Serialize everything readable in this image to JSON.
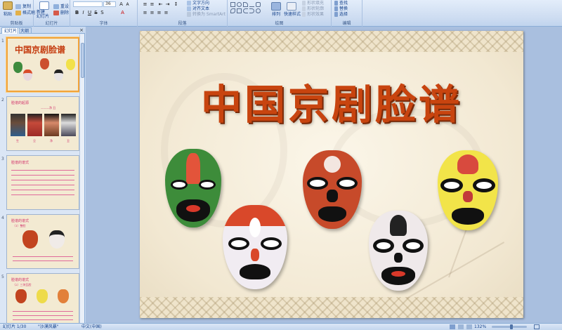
{
  "ribbon": {
    "groups": {
      "clipboard": "剪贴板",
      "slides": "幻灯片",
      "font": "字体",
      "paragraph": "段落",
      "drawing": "绘图",
      "editing": "编辑"
    },
    "paste_label": "粘贴",
    "copy_label": "复制",
    "format_painter_label": "格式刷",
    "new_slide_label": "新建\n幻灯片",
    "reset_label": "重设",
    "delete_label": "删除",
    "font_size": "36",
    "text_direction_label": "文字方向",
    "align_text_label": "对齐文本",
    "smartart_label": "转换为 SmartArt",
    "arrange_label": "排列",
    "quick_styles_label": "快速样式",
    "shape_fill_label": "形状填充",
    "shape_outline_label": "形状轮廓",
    "shape_effects_label": "形状效果",
    "find_label": "查找",
    "replace_label": "替换",
    "select_label": "选择"
  },
  "panel": {
    "tabs": [
      "幻灯片",
      "大纲"
    ],
    "close": "×"
  },
  "thumbnails": [
    {
      "num": "1",
      "title": "中国京剧脸谱"
    },
    {
      "num": "2",
      "title": "脸谱的起源",
      "subtitle": "———净 丑",
      "captions": [
        "生",
        "旦",
        "净",
        "丑"
      ]
    },
    {
      "num": "3",
      "title": "脸谱的谱式"
    },
    {
      "num": "4",
      "title": "脸谱的谱式",
      "subtitle": "（1）整脸"
    },
    {
      "num": "5",
      "title": "脸谱的谱式",
      "subtitle": "（2）三块瓦脸"
    }
  ],
  "slide": {
    "title": "中国京剧脸谱"
  },
  "status": {
    "slide_pos": "幻灯片 1/30",
    "theme": "\"沙漠风暴\"",
    "language": "中文(中国)",
    "zoom": "132%"
  },
  "colors": {
    "title": "#c8440f",
    "ribbon": "#cddcf1",
    "selected_thumb": "#f2a33a"
  }
}
